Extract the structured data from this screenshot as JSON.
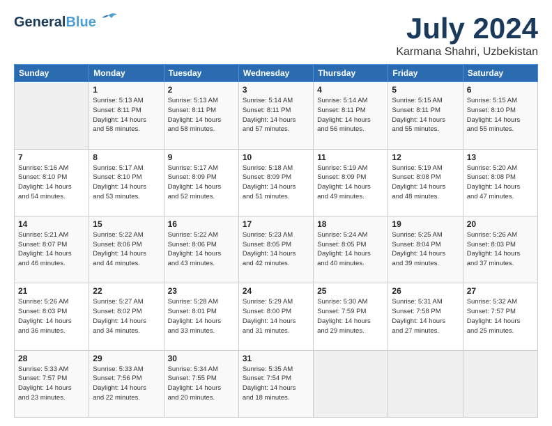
{
  "header": {
    "logo_line1": "General",
    "logo_line2": "Blue",
    "title": "July 2024",
    "subtitle": "Karmana Shahri, Uzbekistan"
  },
  "days_of_week": [
    "Sunday",
    "Monday",
    "Tuesday",
    "Wednesday",
    "Thursday",
    "Friday",
    "Saturday"
  ],
  "weeks": [
    [
      {
        "day": "",
        "info": ""
      },
      {
        "day": "1",
        "info": "Sunrise: 5:13 AM\nSunset: 8:11 PM\nDaylight: 14 hours\nand 58 minutes."
      },
      {
        "day": "2",
        "info": "Sunrise: 5:13 AM\nSunset: 8:11 PM\nDaylight: 14 hours\nand 58 minutes."
      },
      {
        "day": "3",
        "info": "Sunrise: 5:14 AM\nSunset: 8:11 PM\nDaylight: 14 hours\nand 57 minutes."
      },
      {
        "day": "4",
        "info": "Sunrise: 5:14 AM\nSunset: 8:11 PM\nDaylight: 14 hours\nand 56 minutes."
      },
      {
        "day": "5",
        "info": "Sunrise: 5:15 AM\nSunset: 8:11 PM\nDaylight: 14 hours\nand 55 minutes."
      },
      {
        "day": "6",
        "info": "Sunrise: 5:15 AM\nSunset: 8:10 PM\nDaylight: 14 hours\nand 55 minutes."
      }
    ],
    [
      {
        "day": "7",
        "info": "Sunrise: 5:16 AM\nSunset: 8:10 PM\nDaylight: 14 hours\nand 54 minutes."
      },
      {
        "day": "8",
        "info": "Sunrise: 5:17 AM\nSunset: 8:10 PM\nDaylight: 14 hours\nand 53 minutes."
      },
      {
        "day": "9",
        "info": "Sunrise: 5:17 AM\nSunset: 8:09 PM\nDaylight: 14 hours\nand 52 minutes."
      },
      {
        "day": "10",
        "info": "Sunrise: 5:18 AM\nSunset: 8:09 PM\nDaylight: 14 hours\nand 51 minutes."
      },
      {
        "day": "11",
        "info": "Sunrise: 5:19 AM\nSunset: 8:09 PM\nDaylight: 14 hours\nand 49 minutes."
      },
      {
        "day": "12",
        "info": "Sunrise: 5:19 AM\nSunset: 8:08 PM\nDaylight: 14 hours\nand 48 minutes."
      },
      {
        "day": "13",
        "info": "Sunrise: 5:20 AM\nSunset: 8:08 PM\nDaylight: 14 hours\nand 47 minutes."
      }
    ],
    [
      {
        "day": "14",
        "info": "Sunrise: 5:21 AM\nSunset: 8:07 PM\nDaylight: 14 hours\nand 46 minutes."
      },
      {
        "day": "15",
        "info": "Sunrise: 5:22 AM\nSunset: 8:06 PM\nDaylight: 14 hours\nand 44 minutes."
      },
      {
        "day": "16",
        "info": "Sunrise: 5:22 AM\nSunset: 8:06 PM\nDaylight: 14 hours\nand 43 minutes."
      },
      {
        "day": "17",
        "info": "Sunrise: 5:23 AM\nSunset: 8:05 PM\nDaylight: 14 hours\nand 42 minutes."
      },
      {
        "day": "18",
        "info": "Sunrise: 5:24 AM\nSunset: 8:05 PM\nDaylight: 14 hours\nand 40 minutes."
      },
      {
        "day": "19",
        "info": "Sunrise: 5:25 AM\nSunset: 8:04 PM\nDaylight: 14 hours\nand 39 minutes."
      },
      {
        "day": "20",
        "info": "Sunrise: 5:26 AM\nSunset: 8:03 PM\nDaylight: 14 hours\nand 37 minutes."
      }
    ],
    [
      {
        "day": "21",
        "info": "Sunrise: 5:26 AM\nSunset: 8:03 PM\nDaylight: 14 hours\nand 36 minutes."
      },
      {
        "day": "22",
        "info": "Sunrise: 5:27 AM\nSunset: 8:02 PM\nDaylight: 14 hours\nand 34 minutes."
      },
      {
        "day": "23",
        "info": "Sunrise: 5:28 AM\nSunset: 8:01 PM\nDaylight: 14 hours\nand 33 minutes."
      },
      {
        "day": "24",
        "info": "Sunrise: 5:29 AM\nSunset: 8:00 PM\nDaylight: 14 hours\nand 31 minutes."
      },
      {
        "day": "25",
        "info": "Sunrise: 5:30 AM\nSunset: 7:59 PM\nDaylight: 14 hours\nand 29 minutes."
      },
      {
        "day": "26",
        "info": "Sunrise: 5:31 AM\nSunset: 7:58 PM\nDaylight: 14 hours\nand 27 minutes."
      },
      {
        "day": "27",
        "info": "Sunrise: 5:32 AM\nSunset: 7:57 PM\nDaylight: 14 hours\nand 25 minutes."
      }
    ],
    [
      {
        "day": "28",
        "info": "Sunrise: 5:33 AM\nSunset: 7:57 PM\nDaylight: 14 hours\nand 23 minutes."
      },
      {
        "day": "29",
        "info": "Sunrise: 5:33 AM\nSunset: 7:56 PM\nDaylight: 14 hours\nand 22 minutes."
      },
      {
        "day": "30",
        "info": "Sunrise: 5:34 AM\nSunset: 7:55 PM\nDaylight: 14 hours\nand 20 minutes."
      },
      {
        "day": "31",
        "info": "Sunrise: 5:35 AM\nSunset: 7:54 PM\nDaylight: 14 hours\nand 18 minutes."
      },
      {
        "day": "",
        "info": ""
      },
      {
        "day": "",
        "info": ""
      },
      {
        "day": "",
        "info": ""
      }
    ]
  ]
}
